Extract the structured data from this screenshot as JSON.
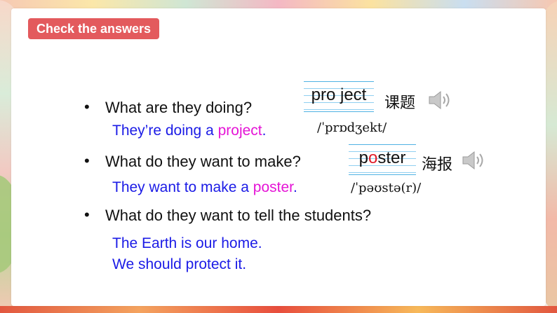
{
  "header": {
    "label": "Check the answers"
  },
  "items": [
    {
      "question": "What are they doing?",
      "answer_pre": "They’re doing a ",
      "answer_kw": "project",
      "answer_post": "."
    },
    {
      "question": "What do they want to make?",
      "answer_pre": "They want to make a ",
      "answer_kw": "poster",
      "answer_post": "."
    },
    {
      "question": "What do they want to tell the students?",
      "answer_line1": "The Earth is our home.",
      "answer_line2": "We should protect it."
    }
  ],
  "vocab": [
    {
      "word_part1": "pro",
      "word_part2": "ject",
      "chinese": "课题",
      "ipa": "/ˈprɒdʒekt/",
      "icon": "speaker-icon"
    },
    {
      "word_part1": "p",
      "word_hl": "o",
      "word_part2": "ster",
      "chinese": "海报",
      "ipa": "/ˈpəʊstə(r)/",
      "icon": "speaker-icon"
    }
  ],
  "colors": {
    "header_bg": "#e35a5d",
    "answer": "#1b1be6",
    "keyword": "#e514d6",
    "highlight": "#e01c2a",
    "lines": "#4fb2e3"
  }
}
